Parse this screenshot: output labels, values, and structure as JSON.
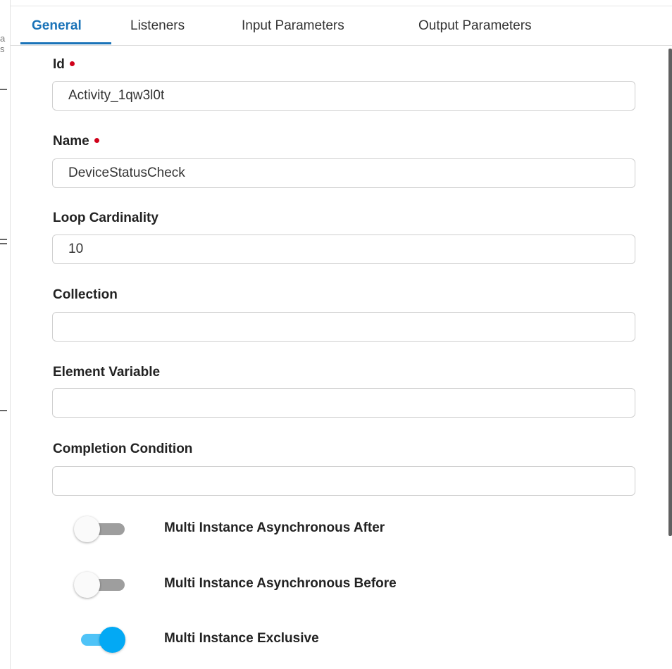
{
  "tabs": [
    {
      "label": "General",
      "active": true
    },
    {
      "label": "Listeners",
      "active": false
    },
    {
      "label": "Input Parameters",
      "active": false
    },
    {
      "label": "Output Parameters",
      "active": false
    }
  ],
  "fields": {
    "id": {
      "label": "Id",
      "required": true,
      "value": "Activity_1qw3l0t"
    },
    "name": {
      "label": "Name",
      "required": true,
      "value": "DeviceStatusCheck"
    },
    "loop_cardinality": {
      "label": "Loop Cardinality",
      "value": "10"
    },
    "collection": {
      "label": "Collection",
      "value": ""
    },
    "element_variable": {
      "label": "Element Variable",
      "value": ""
    },
    "completion_condition": {
      "label": "Completion Condition",
      "value": ""
    }
  },
  "toggles": [
    {
      "label": "Multi Instance Asynchronous After",
      "on": false
    },
    {
      "label": "Multi Instance Asynchronous Before",
      "on": false
    },
    {
      "label": "Multi Instance Exclusive",
      "on": true
    }
  ],
  "colors": {
    "accent": "#1a73b8",
    "required_dot": "#d0021b",
    "toggle_on_knob": "#03a9f4",
    "toggle_on_track": "#4fc3f7",
    "toggle_off_track": "#9e9e9e"
  },
  "left_edge": {
    "chars": [
      "a",
      "s"
    ]
  }
}
